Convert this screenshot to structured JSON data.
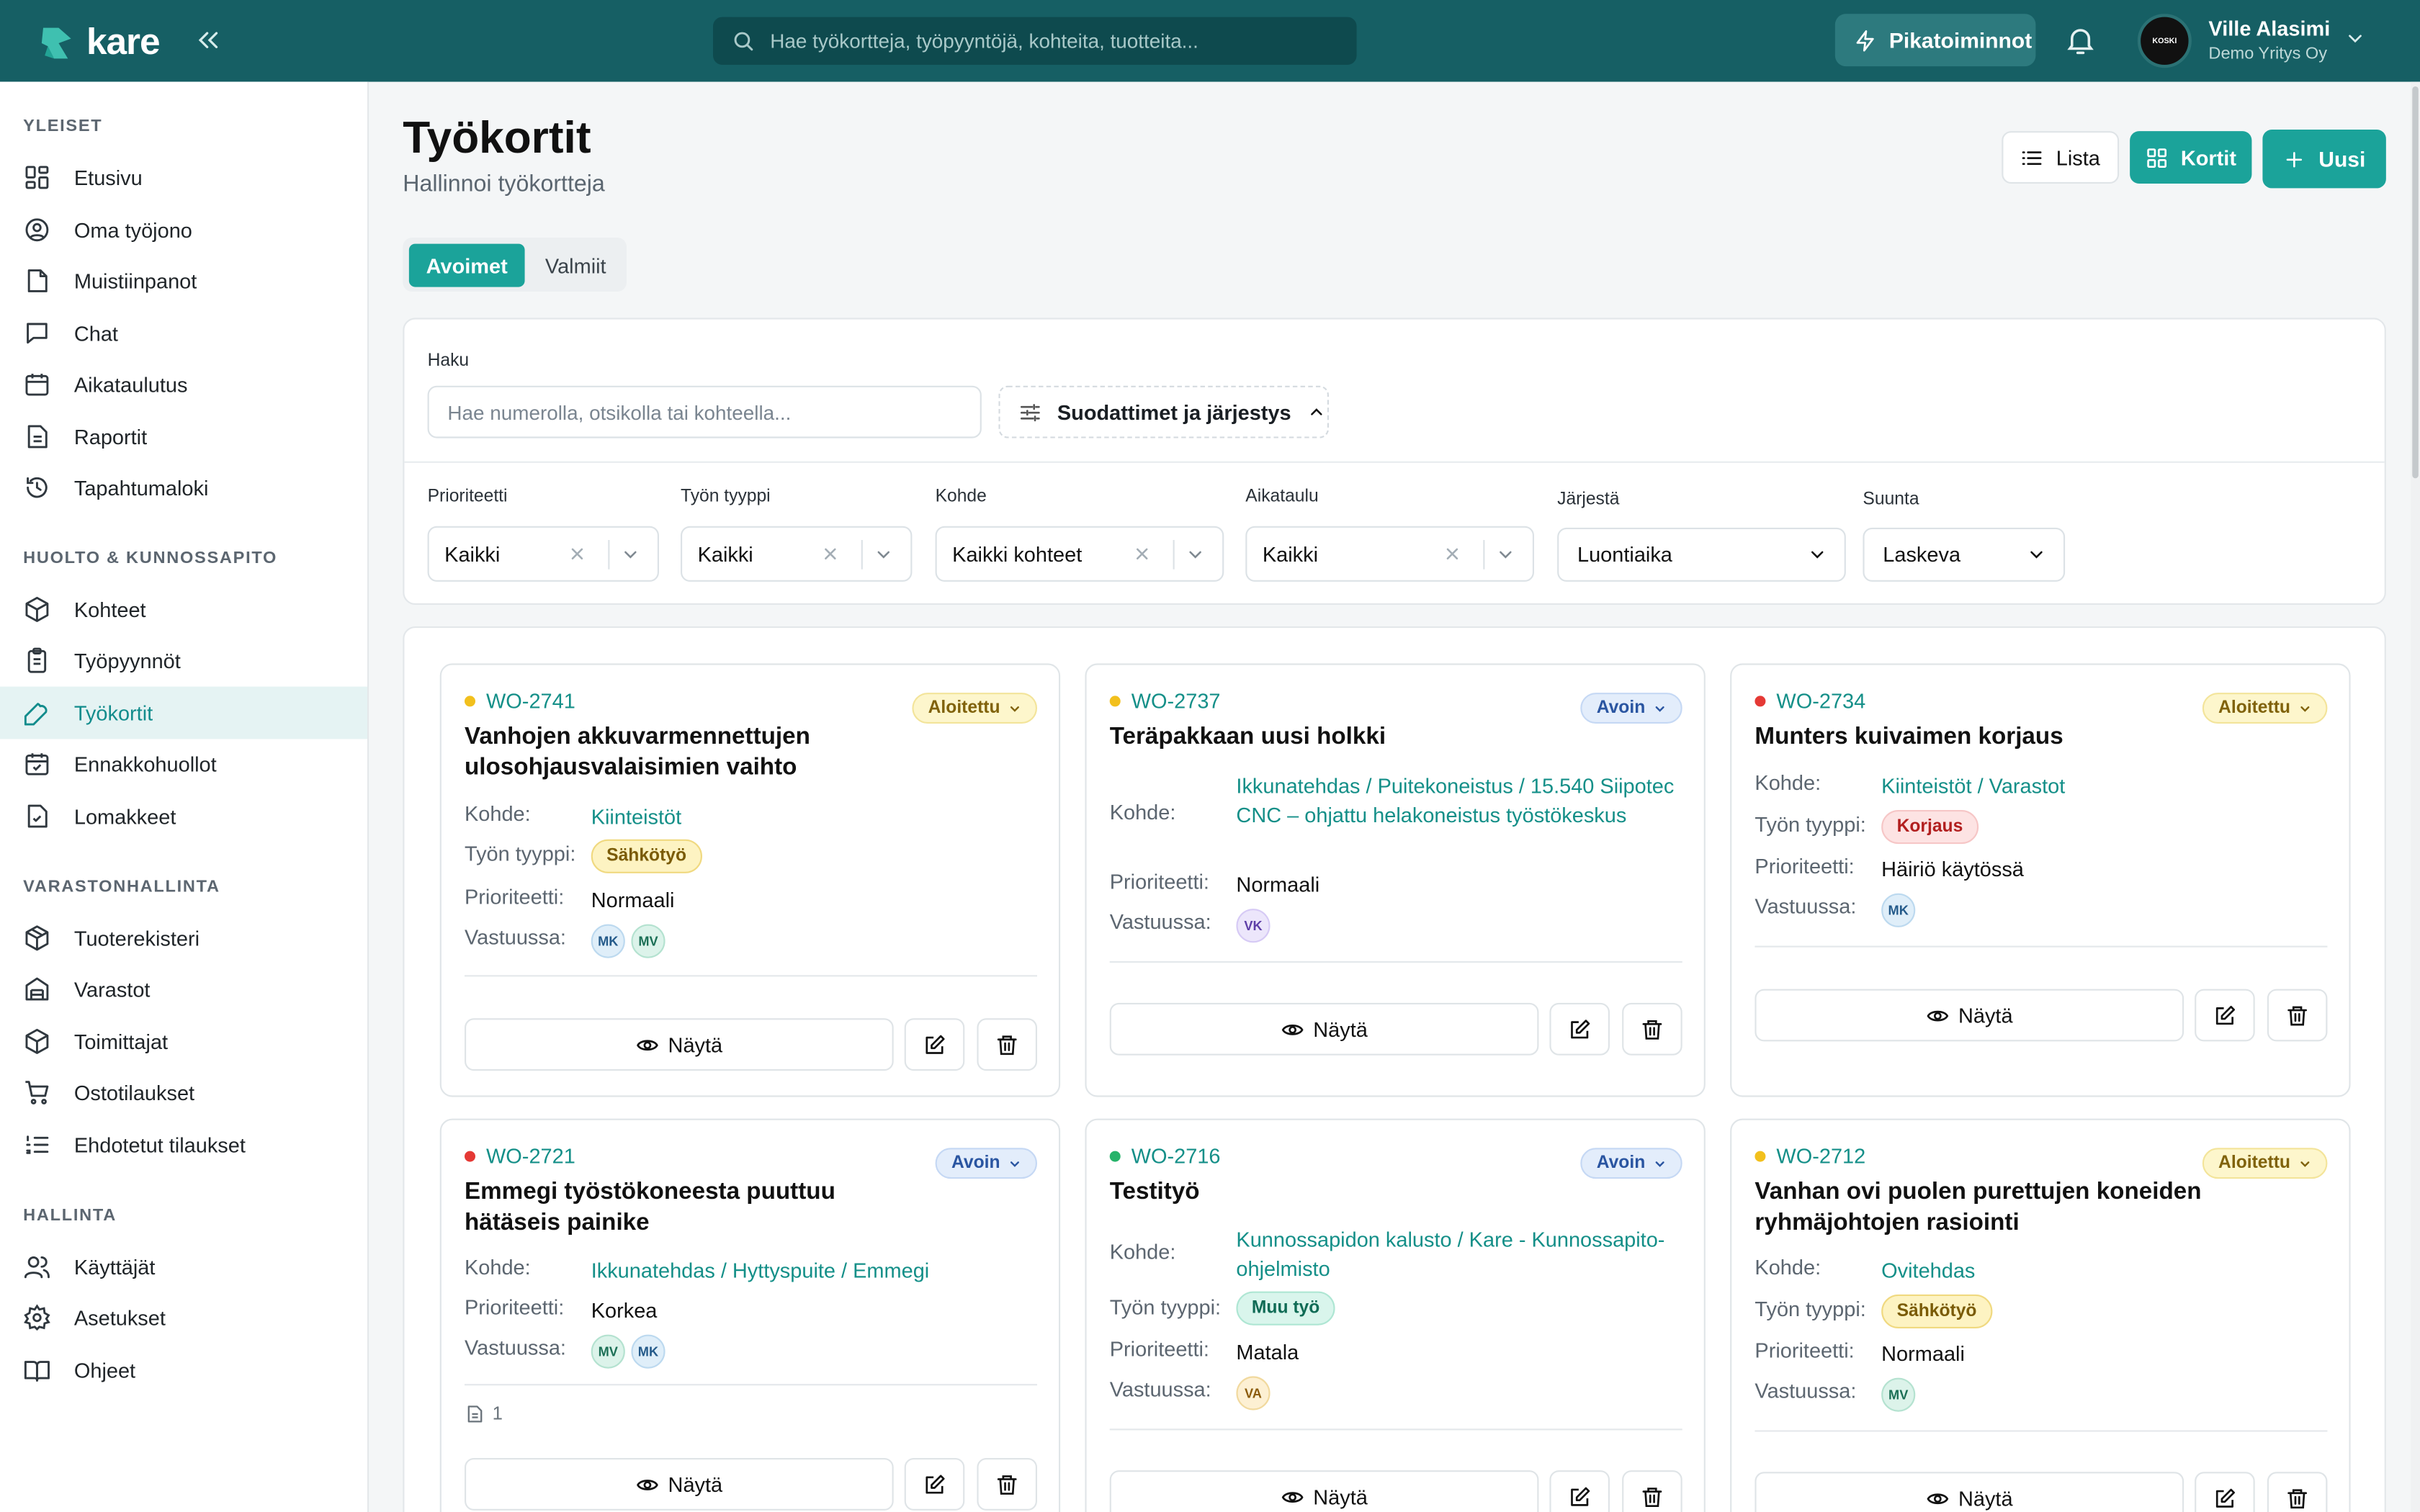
{
  "app": {
    "logo_text": "kare",
    "search_placeholder": "Hae työkortteja, työpyyntöjä, kohteita, tuotteita...",
    "quick_actions": "Pikatoiminnot",
    "user": {
      "name": "Ville Alasimi",
      "org": "Demo Yritys Oy",
      "avatar_text": "KOSKI"
    }
  },
  "sidebar": {
    "sections": [
      {
        "title": "YLEISET",
        "items": [
          {
            "label": "Etusivu",
            "icon": "dashboard-icon"
          },
          {
            "label": "Oma työjono",
            "icon": "user-circle-icon"
          },
          {
            "label": "Muistiinpanot",
            "icon": "note-icon"
          },
          {
            "label": "Chat",
            "icon": "chat-icon"
          },
          {
            "label": "Aikataulutus",
            "icon": "calendar-icon"
          },
          {
            "label": "Raportit",
            "icon": "report-icon"
          },
          {
            "label": "Tapahtumaloki",
            "icon": "history-icon"
          }
        ]
      },
      {
        "title": "HUOLTO & KUNNOSSAPITO",
        "items": [
          {
            "label": "Kohteet",
            "icon": "box-icon"
          },
          {
            "label": "Työpyynnöt",
            "icon": "clipboard-icon"
          },
          {
            "label": "Työkortit",
            "icon": "wrench-icon",
            "active": true
          },
          {
            "label": "Ennakkohuollot",
            "icon": "calendar-check-icon"
          },
          {
            "label": "Lomakkeet",
            "icon": "form-check-icon"
          }
        ]
      },
      {
        "title": "VARASTONHALLINTA",
        "items": [
          {
            "label": "Tuoterekisteri",
            "icon": "package-icon"
          },
          {
            "label": "Varastot",
            "icon": "warehouse-icon"
          },
          {
            "label": "Toimittajat",
            "icon": "supplier-icon"
          },
          {
            "label": "Ostotilaukset",
            "icon": "cart-icon"
          },
          {
            "label": "Ehdotetut tilaukset",
            "icon": "list-ordered-icon"
          }
        ]
      },
      {
        "title": "HALLINTA",
        "items": [
          {
            "label": "Käyttäjät",
            "icon": "users-icon"
          },
          {
            "label": "Asetukset",
            "icon": "gear-icon"
          },
          {
            "label": "Ohjeet",
            "icon": "book-icon"
          }
        ]
      }
    ]
  },
  "page": {
    "title": "Työkortit",
    "subtitle": "Hallinnoi työkortteja",
    "view_list": "Lista",
    "view_cards": "Kortit",
    "new": "Uusi",
    "tabs": [
      "Avoimet",
      "Valmiit"
    ]
  },
  "filters": {
    "search_label": "Haku",
    "search_placeholder": "Hae numerolla, otsikolla tai kohteella...",
    "toggle_label": "Suodattimet ja järjestys",
    "selects": [
      {
        "label": "Prioriteetti",
        "value": "Kaikki"
      },
      {
        "label": "Työn tyyppi",
        "value": "Kaikki"
      },
      {
        "label": "Kohde",
        "value": "Kaikki kohteet"
      },
      {
        "label": "Aikataulu",
        "value": "Kaikki"
      },
      {
        "label": "Järjestä",
        "value": "Luontiaika"
      },
      {
        "label": "Suunta",
        "value": "Laskeva"
      }
    ]
  },
  "labels": {
    "target": "Kohde:",
    "work_type": "Työn tyyppi:",
    "priority": "Prioriteetti:",
    "responsible": "Vastuussa:",
    "view": "Näytä"
  },
  "colors": {
    "brand": "#165f64",
    "accent": "#1ba39a",
    "dot_yellow": "#f2c01d",
    "dot_red": "#e53935",
    "dot_green": "#26b36a"
  },
  "cards": [
    {
      "id": "WO-2741",
      "status": "Aloitettu",
      "title": "Vanhojen akkuvarmennettujen ulosohjausvalaisimien vaihto",
      "target": "Kiinteistöt",
      "work_type": "Sähkötyö",
      "priority": "Normaali",
      "assignees": [
        "MK",
        "MV"
      ]
    },
    {
      "id": "WO-2737",
      "status": "Avoin",
      "title": "Teräpakkaan uusi holkki",
      "target": "Ikkunatehdas / Puitekoneistus / 15.540 Siipotec CNC – ohjattu helakoneistus työstökeskus",
      "priority": "Normaali",
      "assignees": [
        "VK"
      ]
    },
    {
      "id": "WO-2734",
      "status": "Aloitettu",
      "title": "Munters kuivaimen korjaus",
      "target": "Kiinteistöt / Varastot",
      "work_type": "Korjaus",
      "priority": "Häiriö käytössä",
      "assignees": [
        "MK"
      ]
    },
    {
      "id": "WO-2721",
      "status": "Avoin",
      "title": "Emmegi työstökoneesta puuttuu hätäseis painike",
      "target": "Ikkunatehdas / Hyttyspuite / Emmegi",
      "priority": "Korkea",
      "assignees": [
        "MV",
        "MK"
      ],
      "attachments": "1"
    },
    {
      "id": "WO-2716",
      "status": "Avoin",
      "title": "Testityö",
      "target": "Kunnossapidon kalusto / Kare - Kunnossapito-ohjelmisto",
      "work_type": "Muu työ",
      "priority": "Matala",
      "assignees": [
        "VA"
      ]
    },
    {
      "id": "WO-2712",
      "status": "Aloitettu",
      "title": "Vanhan ovi puolen purettujen koneiden ryhmäjohtojen rasiointi",
      "target": "Ovitehdas",
      "work_type": "Sähkötyö",
      "priority": "Normaali",
      "assignees": [
        "MV"
      ]
    }
  ]
}
